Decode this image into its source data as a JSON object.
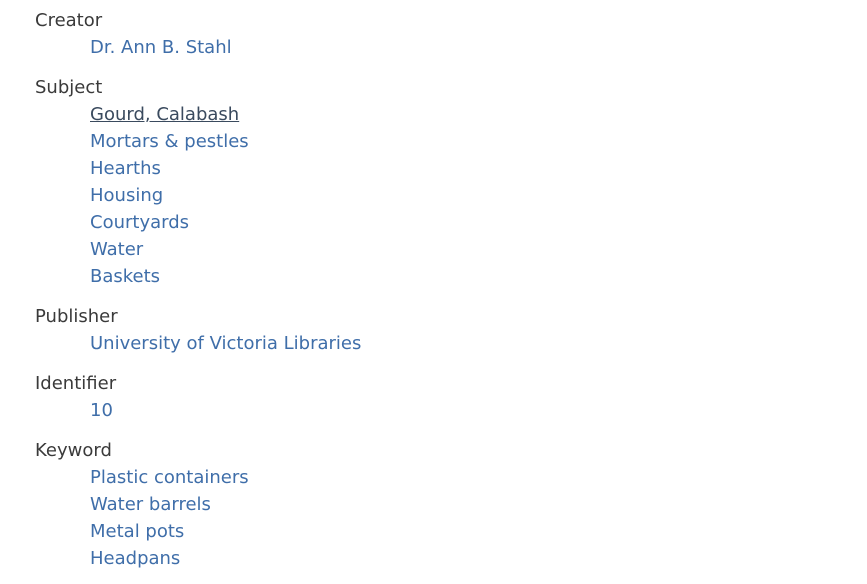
{
  "fields": [
    {
      "label": "Creator",
      "values": [
        "Dr. Ann B. Stahl"
      ]
    },
    {
      "label": "Subject",
      "values": [
        "Gourd, Calabash",
        "Mortars & pestles",
        "Hearths",
        "Housing",
        "Courtyards",
        "Water",
        "Baskets"
      ],
      "hovered_index": 0
    },
    {
      "label": "Publisher",
      "values": [
        "University of Victoria Libraries"
      ]
    },
    {
      "label": "Identifier",
      "values": [
        "10"
      ]
    },
    {
      "label": "Keyword",
      "values": [
        "Plastic containers",
        "Water barrels",
        "Metal pots",
        "Headpans"
      ]
    }
  ],
  "colors": {
    "label": "#3a3a3a",
    "link": "#3f6ea9",
    "link_hover": "#3a4a5e"
  }
}
